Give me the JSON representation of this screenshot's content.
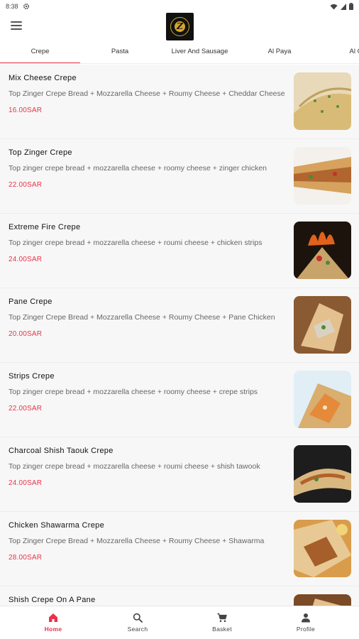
{
  "status_bar": {
    "time": "8:38"
  },
  "tabs": [
    "Crepe",
    "Pasta",
    "Liver And Sausage",
    "Al Paya",
    "Al Gor"
  ],
  "items": [
    {
      "name": "Mix Cheese Crepe",
      "description": "Top Zinger Crepe Bread + Mozzarella Cheese + Roumy Cheese + Cheddar Cheese",
      "price": "16.00SAR"
    },
    {
      "name": "Top Zinger Crepe",
      "description": "Top zinger crepe bread + mozzarella cheese + roomy cheese + zinger chicken",
      "price": "22.00SAR"
    },
    {
      "name": "Extreme Fire Crepe",
      "description": "Top zinger crepe bread + mozzarella cheese + roumi cheese + chicken strips",
      "price": "24.00SAR"
    },
    {
      "name": "Pane Crepe",
      "description": "Top Zinger Crepe Bread + Mozzarella Cheese + Roumy Cheese + Pane Chicken",
      "price": "20.00SAR"
    },
    {
      "name": "Strips Crepe",
      "description": "Top zinger crepe bread + mozzarella cheese + roomy cheese + crepe strips",
      "price": "22.00SAR"
    },
    {
      "name": "Charcoal Shish Taouk Crepe",
      "description": "Top zinger crepe bread + mozzarella cheese + roumi cheese + shish tawook",
      "price": "24.00SAR"
    },
    {
      "name": "Chicken Shawarma Crepe",
      "description": "Top Zinger Crepe Bread + Mozzarella Cheese + Roumy Cheese + Shawarma",
      "price": "28.00SAR"
    },
    {
      "name": "Shish Crepe On A Pane",
      "description": "",
      "price": ""
    }
  ],
  "bottom_nav": [
    {
      "label": "Home",
      "icon": "home-icon"
    },
    {
      "label": "Search",
      "icon": "search-icon"
    },
    {
      "label": "Basket",
      "icon": "cart-icon"
    },
    {
      "label": "Profile",
      "icon": "profile-icon"
    }
  ],
  "colors": {
    "accent": "#e8334a",
    "background": "#f7f7f7",
    "logo_gold": "#d4a72c"
  }
}
